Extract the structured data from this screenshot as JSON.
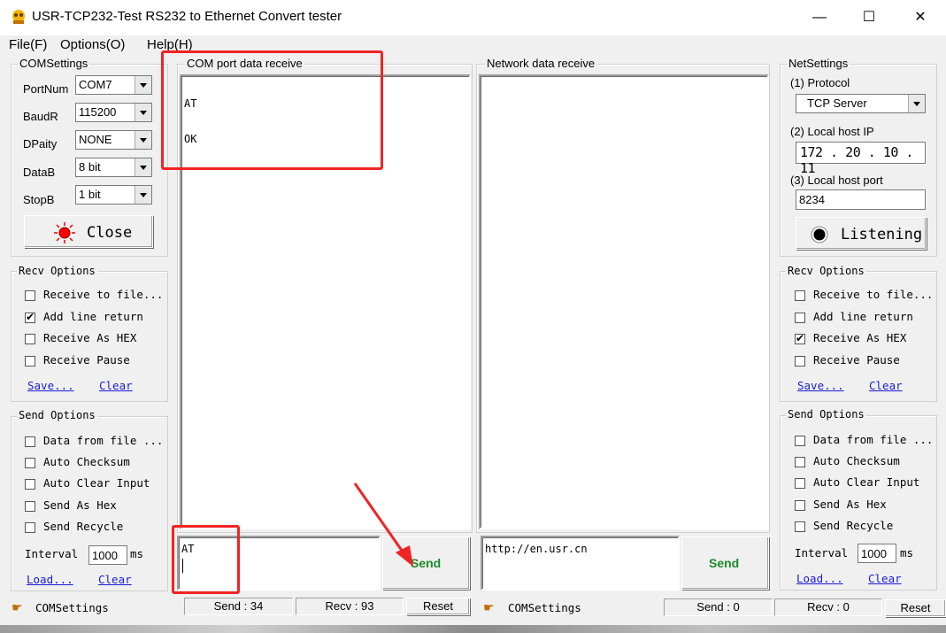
{
  "window": {
    "title": "USR-TCP232-Test  RS232 to Ethernet Convert tester",
    "minimize": "—",
    "maximize": "☐",
    "close": "✕"
  },
  "menu": [
    "File(F)",
    "Options(O)",
    "Help(H)"
  ],
  "com_settings": {
    "label": "COMSettings",
    "port_num_label": "PortNum",
    "port_num": "COM7",
    "baud_label": "BaudR",
    "baud": "115200",
    "parity_label": "DPaity",
    "parity": "NONE",
    "databits_label": "DataB",
    "databits": "8 bit",
    "stopbits_label": "StopB",
    "stopbits": "1 bit",
    "close_button": "Close"
  },
  "left_recv_options": {
    "label": "Recv Options",
    "items": [
      {
        "label": "Receive to file...",
        "checked": false
      },
      {
        "label": "Add line return",
        "checked": true
      },
      {
        "label": "Receive As HEX",
        "checked": false
      },
      {
        "label": "Receive Pause",
        "checked": false
      }
    ],
    "save": "Save...",
    "clear": "Clear"
  },
  "left_send_options": {
    "label": "Send Options",
    "items": [
      {
        "label": "Data from file ...",
        "checked": false
      },
      {
        "label": "Auto Checksum",
        "checked": false
      },
      {
        "label": "Auto Clear Input",
        "checked": false
      },
      {
        "label": "Send As Hex",
        "checked": false
      },
      {
        "label": "Send Recycle",
        "checked": false
      }
    ],
    "interval_label": "Interval",
    "interval": "1000",
    "interval_unit": "ms",
    "load": "Load...",
    "clear": "Clear"
  },
  "com_receive": {
    "label": "COM port data receive",
    "lines": [
      "AT",
      "OK"
    ],
    "send_input": "AT",
    "send_button": "Send"
  },
  "net_receive": {
    "label": "Network data receive",
    "send_input": "http://en.usr.cn",
    "send_button": "Send"
  },
  "net_settings": {
    "label": "NetSettings",
    "protocol_label": "(1) Protocol",
    "protocol": "TCP Server",
    "ip_label": "(2) Local host IP",
    "ip": "172 . 20 . 10 . 11",
    "port_label": "(3) Local host port",
    "port": "8234",
    "listen_button": "Listening"
  },
  "right_recv_options": {
    "label": "Recv Options",
    "items": [
      {
        "label": "Receive to file...",
        "checked": false
      },
      {
        "label": "Add line return",
        "checked": false
      },
      {
        "label": "Receive As HEX",
        "checked": true
      },
      {
        "label": "Receive Pause",
        "checked": false
      }
    ],
    "save": "Save...",
    "clear": "Clear"
  },
  "right_send_options": {
    "label": "Send Options",
    "items": [
      {
        "label": "Data from file ...",
        "checked": false
      },
      {
        "label": "Auto Checksum",
        "checked": false
      },
      {
        "label": "Auto Clear Input",
        "checked": false
      },
      {
        "label": "Send As Hex",
        "checked": false
      },
      {
        "label": "Send Recycle",
        "checked": false
      }
    ],
    "interval_label": "Interval",
    "interval": "1000",
    "interval_unit": "ms",
    "load": "Load...",
    "clear": "Clear"
  },
  "status_left": {
    "label": "COMSettings",
    "send": "Send : 34",
    "recv": "Recv : 93",
    "reset": "Reset"
  },
  "status_right": {
    "label": "COMSettings",
    "send": "Send : 0",
    "recv": "Recv : 0",
    "reset": "Reset"
  },
  "colors": {
    "annotation": "#f02424",
    "send_text": "#1b8a2a",
    "link": "#1a1ad6"
  }
}
